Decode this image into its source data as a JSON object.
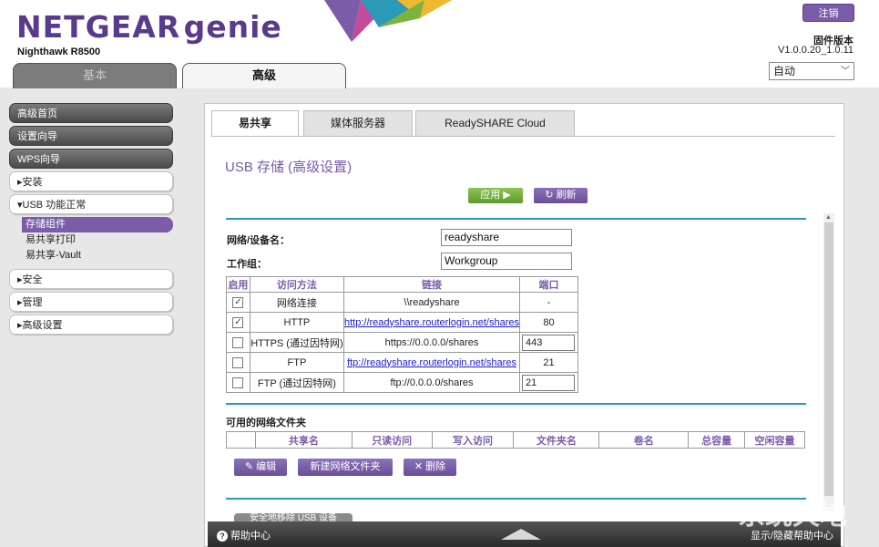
{
  "header": {
    "brand": "NETGEAR",
    "brand_suffix": "genie",
    "model": "Nighthawk R8500",
    "logout_label": "注销",
    "firmware_label": "固件版本",
    "firmware_version": "V1.0.0.20_1.0.11",
    "language_value": "自动"
  },
  "top_tabs": {
    "basic": "基本",
    "advanced": "高级"
  },
  "sidebar": {
    "items": [
      {
        "label": "高级首页"
      },
      {
        "label": "设置向导"
      },
      {
        "label": "WPS向导"
      },
      {
        "label": "▸安装"
      },
      {
        "label": "▾USB 功能正常"
      }
    ],
    "sub_items": [
      {
        "label": "存储组件"
      },
      {
        "label": "易共享打印"
      },
      {
        "label": "易共享-Vault"
      }
    ],
    "more_items": [
      {
        "label": "▸安全"
      },
      {
        "label": "▸管理"
      },
      {
        "label": "▸高级设置"
      }
    ]
  },
  "panel": {
    "tabs": [
      "易共享",
      "媒体服务器",
      "ReadySHARE Cloud"
    ],
    "title": "USB 存储 (高级设置)",
    "apply_label": "应用 ▶",
    "refresh_label": "刷新",
    "device_name_label": "网络/设备名：",
    "device_name_value": "readyshare",
    "workgroup_label": "工作组：",
    "workgroup_value": "Workgroup",
    "access_table": {
      "headers": [
        "启用",
        "访问方法",
        "链接",
        "端口"
      ],
      "rows": [
        {
          "checked": "✓",
          "method": "网络连接",
          "link": "\\\\readyshare",
          "port": "-"
        },
        {
          "checked": "✓",
          "method": "HTTP",
          "link": "http://readyshare.routerlogin.net/shares",
          "port": "80"
        },
        {
          "checked": "",
          "method": "HTTPS (通过因特网)",
          "link": "https://0.0.0.0/shares",
          "port": "443"
        },
        {
          "checked": "",
          "method": "FTP",
          "link": "ftp://readyshare.routerlogin.net/shares",
          "port": "21"
        },
        {
          "checked": "",
          "method": "FTP (通过因特网)",
          "link": "ftp://0.0.0.0/shares",
          "port": "21"
        }
      ]
    },
    "folders_label": "可用的网络文件夹",
    "folders_table": {
      "headers": [
        "",
        "共享名",
        "只读访问",
        "写入访问",
        "文件夹名",
        "卷名",
        "总容量",
        "空闲容量"
      ]
    },
    "edit_label": "编辑",
    "new_folder_label": "新建网络文件夹",
    "delete_label": "删除",
    "safe_remove_label": "安全地移除 USB 设备"
  },
  "footer": {
    "help_center": "帮助中心",
    "show_help": "显示/隐藏帮助中心"
  },
  "watermark": "系统天地"
}
